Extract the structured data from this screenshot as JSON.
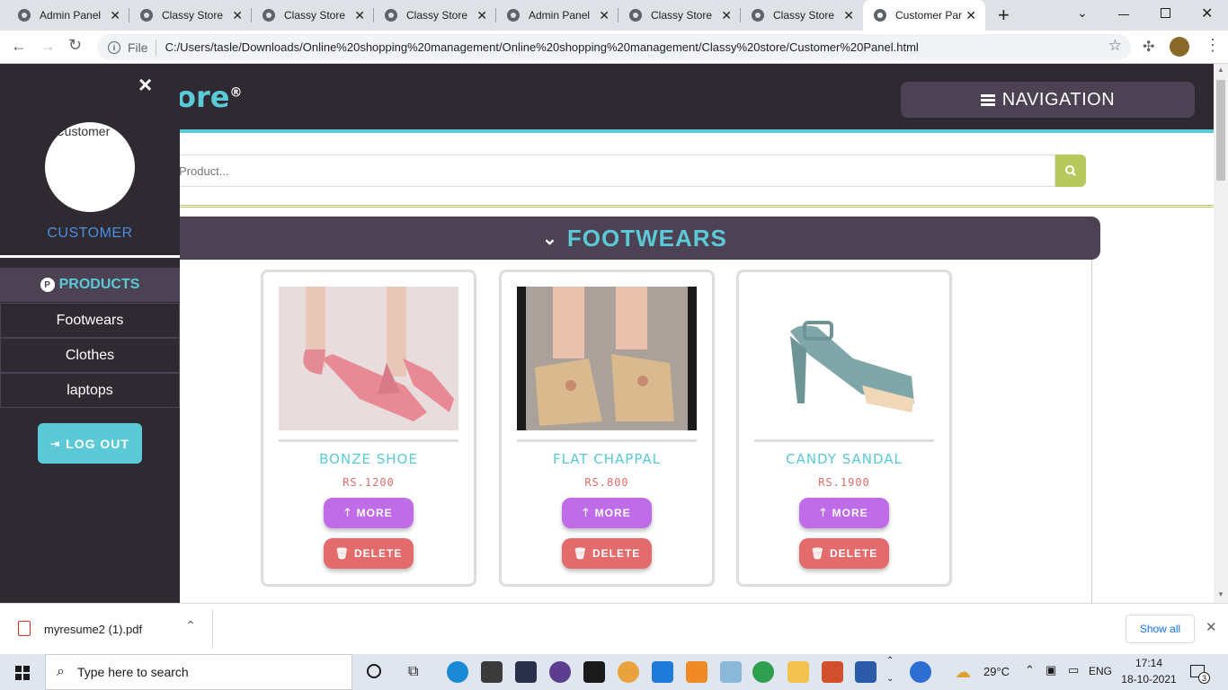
{
  "browser": {
    "tabs": [
      {
        "title": "Admin Panel"
      },
      {
        "title": "Classy Store"
      },
      {
        "title": "Classy Store"
      },
      {
        "title": "Classy Store"
      },
      {
        "title": "Admin Panel"
      },
      {
        "title": "Classy Store"
      },
      {
        "title": "Classy Store"
      },
      {
        "title": "Customer Par",
        "active": true
      }
    ],
    "new_tab": "+",
    "address": {
      "scheme": "File",
      "url": "C:/Users/tasle/Downloads/Online%20shopping%20management/Online%20shopping%20management/Classy%20store/Customer%20Panel.html"
    }
  },
  "header": {
    "logo_text": "ore",
    "logo_mark": "®",
    "nav_button": "NAVIGATION"
  },
  "search": {
    "placeholder": "Product..."
  },
  "category": {
    "title": "FOOTWEARS"
  },
  "products": [
    {
      "name": "BONZE SHOE",
      "price": "RS.1200",
      "more": "MORE",
      "delete": "DELETE"
    },
    {
      "name": "FLAT CHAPPAL",
      "price": "RS.800",
      "more": "MORE",
      "delete": "DELETE"
    },
    {
      "name": "CANDY SANDAL",
      "price": "RS.1900",
      "more": "MORE",
      "delete": "DELETE"
    }
  ],
  "sidebar": {
    "close": "×",
    "avatar_alt": "Customer",
    "user_label": "CUSTOMER",
    "products_heading": "PRODUCTS",
    "products_badge": "P",
    "items": [
      {
        "label": "Footwears"
      },
      {
        "label": "Clothes"
      },
      {
        "label": "laptops"
      }
    ],
    "logout": "LOG OUT"
  },
  "downloads": {
    "file": "myresume2 (1).pdf",
    "show_all": "Show all"
  },
  "taskbar": {
    "search_placeholder": "Type here to search",
    "weather": "29°C",
    "language": "ENG",
    "time": "17:14",
    "date": "18-10-2021",
    "notification_count": "3"
  }
}
